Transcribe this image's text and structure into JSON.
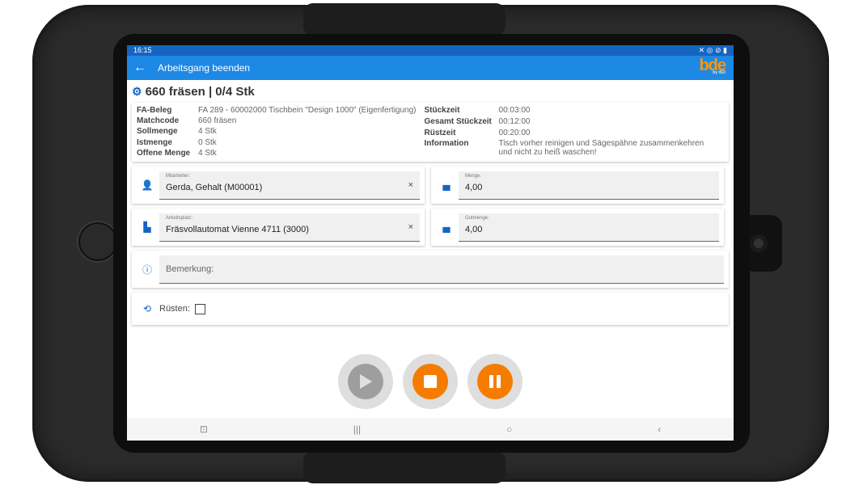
{
  "status": {
    "time": "16:15",
    "icons": "✕ ◎ ⊘ ▮"
  },
  "appbar": {
    "title": "Arbeitsgang beenden",
    "logo": "bde",
    "logo_sub": "by ISO"
  },
  "heading": "660 fräsen | 0/4 Stk",
  "info_left": [
    {
      "key": "FA-Beleg",
      "value": "FA 289 - 60002000 Tischbein \"Design 1000\" (Eigenfertigung)"
    },
    {
      "key": "Matchcode",
      "value": "660 fräsen"
    },
    {
      "key": "Sollmenge",
      "value": "4 Stk"
    },
    {
      "key": "Istmenge",
      "value": "0 Stk"
    },
    {
      "key": "Offene Menge",
      "value": "4 Stk"
    }
  ],
  "info_right": [
    {
      "key": "Stückzeit",
      "value": "00:03:00"
    },
    {
      "key": "Gesamt Stückzeit",
      "value": "00:12:00"
    },
    {
      "key": "Rüstzeit",
      "value": "00:20:00"
    },
    {
      "key": "Information",
      "value": "Tisch vorher reinigen und Sägespähne zusammenkehren und nicht zu heiß waschen!"
    }
  ],
  "fields": {
    "mitarbeiter": {
      "label": "Mitarbeiter:",
      "value": "Gerda, Gehalt (M00001)"
    },
    "menge": {
      "label": "Menge:",
      "value": "4,00"
    },
    "arbeitsplatz": {
      "label": "Arbeitsplatz:",
      "value": "Fräsvollautomat Vienne 4711 (3000)"
    },
    "gutmenge": {
      "label": "Gutmenge:",
      "value": "4,00"
    },
    "bemerkung": {
      "placeholder": "Bemerkung:"
    },
    "rusten": {
      "label": "Rüsten:"
    }
  },
  "clear_symbol": "×",
  "colors": {
    "primary": "#1e88e5",
    "statusbar": "#1565c0",
    "accent": "#f57c00",
    "play": "#9e9e9e"
  }
}
